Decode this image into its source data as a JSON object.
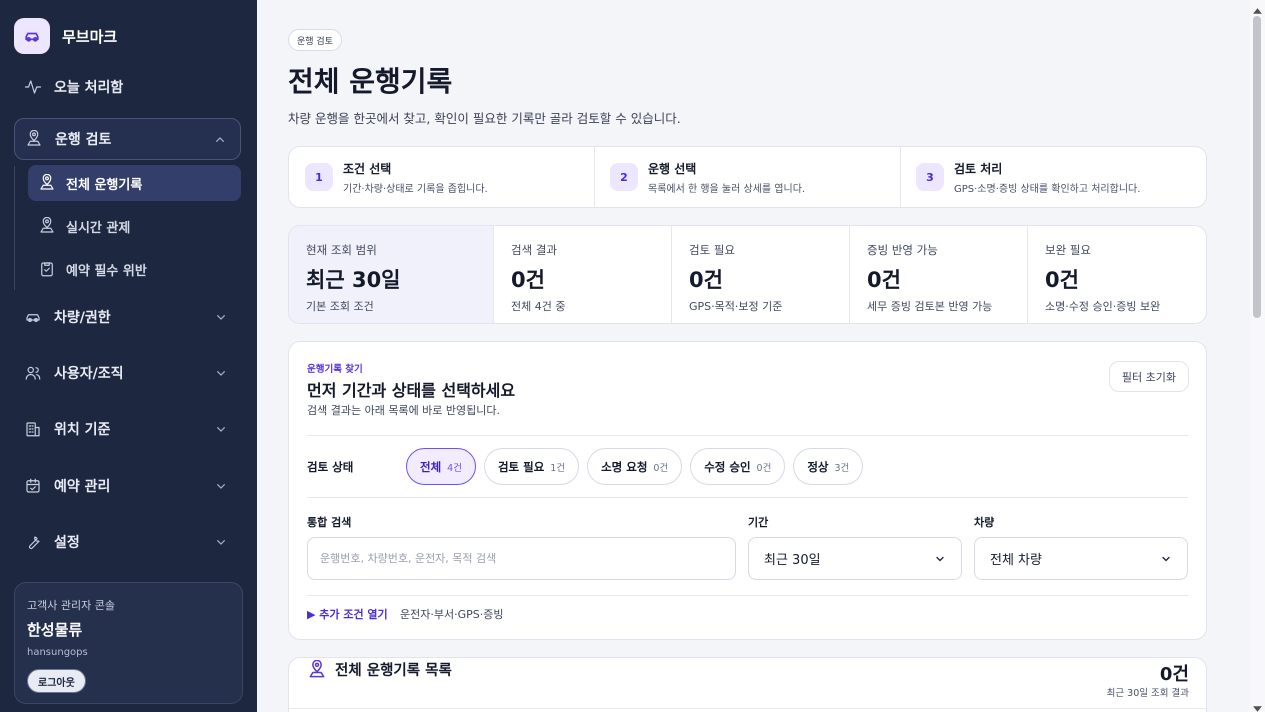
{
  "brand": {
    "name": "무브마크",
    "logo_icon": "car-icon"
  },
  "sidebar": {
    "today": {
      "label": "오늘 처리함",
      "icon": "activity-icon"
    },
    "review_group": {
      "label": "운행 검토",
      "icon": "map-pin-icon",
      "items": [
        {
          "label": "전체 운행기록",
          "icon": "map-pin-icon",
          "active": true
        },
        {
          "label": "실시간 관제",
          "icon": "map-pin-icon"
        },
        {
          "label": "예약 필수 위반",
          "icon": "clipboard-icon"
        }
      ]
    },
    "groups": [
      {
        "label": "차량/권한",
        "icon": "car-icon"
      },
      {
        "label": "사용자/조직",
        "icon": "users-icon"
      },
      {
        "label": "위치 기준",
        "icon": "building-icon"
      },
      {
        "label": "예약 관리",
        "icon": "calendar-icon"
      },
      {
        "label": "설정",
        "icon": "wrench-icon"
      }
    ],
    "account": {
      "role": "고객사 관리자 콘솔",
      "org": "한성물류",
      "user_id": "hansungops",
      "logout_label": "로그아웃"
    }
  },
  "header": {
    "breadcrumb": "운행 검토",
    "title": "전체 운행기록",
    "description": "차량 운행을 한곳에서 찾고, 확인이 필요한 기록만 골라 검토할 수 있습니다."
  },
  "steps": [
    {
      "num": "1",
      "title": "조건 선택",
      "desc": "기간·차량·상태로 기록을 좁힙니다."
    },
    {
      "num": "2",
      "title": "운행 선택",
      "desc": "목록에서 한 행을 눌러 상세를 엽니다."
    },
    {
      "num": "3",
      "title": "검토 처리",
      "desc": "GPS·소명·증빙 상태를 확인하고 처리합니다."
    }
  ],
  "stats": [
    {
      "label": "현재 조회 범위",
      "value": "최근 30일",
      "sub": "기본 조회 조건"
    },
    {
      "label": "검색 결과",
      "value": "0건",
      "sub": "전체 4건 중"
    },
    {
      "label": "검토 필요",
      "value": "0건",
      "sub": "GPS·목적·보정 기준"
    },
    {
      "label": "증빙 반영 가능",
      "value": "0건",
      "sub": "세무 증빙 검토본 반영 가능"
    },
    {
      "label": "보완 필요",
      "value": "0건",
      "sub": "소명·수정 승인·증빙 보완"
    }
  ],
  "filter": {
    "kicker": "운행기록 찾기",
    "title": "먼저 기간과 상태를 선택하세요",
    "description": "검색 결과는 아래 목록에 바로 반영됩니다.",
    "reset_label": "필터 초기화",
    "status_label": "검토 상태",
    "chips": [
      {
        "label": "전체",
        "count": "4건",
        "active": true
      },
      {
        "label": "검토 필요",
        "count": "1건"
      },
      {
        "label": "소명 요청",
        "count": "0건"
      },
      {
        "label": "수정 승인",
        "count": "0건"
      },
      {
        "label": "정상",
        "count": "3건"
      }
    ],
    "search": {
      "label": "통합 검색",
      "placeholder": "운행번호, 차량번호, 운전자, 목적 검색",
      "value": ""
    },
    "period": {
      "label": "기간",
      "selected": "최근 30일"
    },
    "vehicle": {
      "label": "차량",
      "selected": "전체 차량"
    },
    "more_toggle": "▶ 추가 조건 열기",
    "more_desc": "운전자·부서·GPS·증빙"
  },
  "list": {
    "title": "전체 운행기록 목록",
    "icon": "map-pin-icon",
    "count": "0건",
    "sub": "최근 30일 조회 결과"
  },
  "colors": {
    "sidebar_bg": "#1e2740",
    "accent": "#5b36d9",
    "active_nav": "#343e6a",
    "page_bg": "#f4f5f9"
  }
}
